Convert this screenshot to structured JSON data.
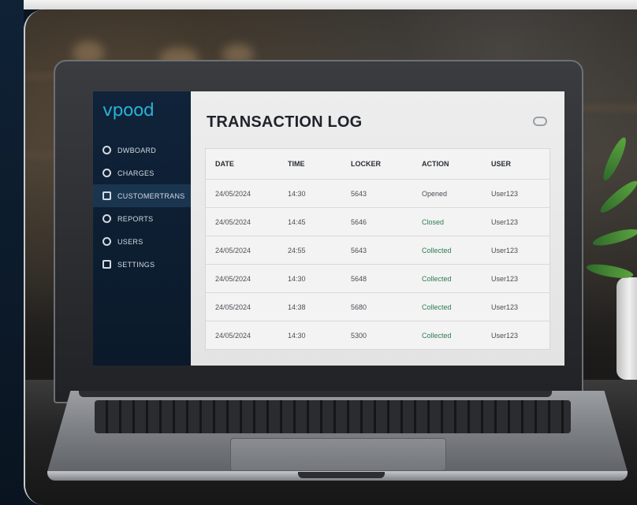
{
  "app": {
    "logo": "vpood"
  },
  "sidebar": {
    "items": [
      {
        "label": "DWBOARD",
        "icon": "dashboard-icon",
        "active": false
      },
      {
        "label": "CHARGES",
        "icon": "charges-icon",
        "active": false
      },
      {
        "label": "CUSTOMERTRANS",
        "icon": "transactions-icon",
        "active": true
      },
      {
        "label": "REPORTS",
        "icon": "reports-icon",
        "active": false
      },
      {
        "label": "USERS",
        "icon": "users-icon",
        "active": false
      },
      {
        "label": "SETTINGS",
        "icon": "settings-icon",
        "active": false
      }
    ]
  },
  "main": {
    "title": "TRANSACTION LOG",
    "link_icon": "link-icon",
    "table": {
      "headers": [
        "DATE",
        "TIME",
        "LOCKER",
        "ACTION",
        "USER"
      ],
      "rows": [
        [
          "24/05/2024",
          "14:30",
          "5643",
          "Opened",
          "User123"
        ],
        [
          "24/05/2024",
          "14:45",
          "5646",
          "Closed",
          "User123"
        ],
        [
          "24/05/2024",
          "24:55",
          "5643",
          "Collected",
          "User123"
        ],
        [
          "24/05/2024",
          "14:30",
          "5648",
          "Collected",
          "User123"
        ],
        [
          "24/05/2024",
          "14:38",
          "5680",
          "Collected",
          "User123"
        ],
        [
          "24/05/2024",
          "14:30",
          "5300",
          "Collected",
          "User123"
        ]
      ]
    }
  },
  "colors": {
    "accent": "#27b3d6",
    "sidebar_bg": "#10233a",
    "status_green": "#2f7a53"
  }
}
